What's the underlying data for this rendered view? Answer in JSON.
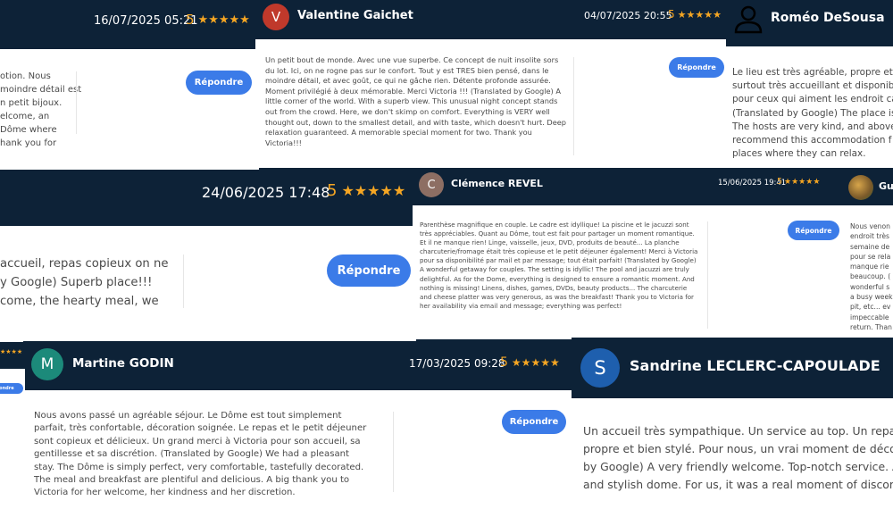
{
  "reply_label": "Répondre",
  "colors": {
    "header": "#0d2237",
    "accent_star": "#f5a623",
    "button": "#3b7be8"
  },
  "reviews": [
    {
      "author": "",
      "date": "16/07/2025 05:21",
      "rating": "5",
      "stars": "★★★★★",
      "text": "otion. Nous\nmoindre détail est\nn petit bijoux.\nelcome, an\nDôme where\nhank you for"
    },
    {
      "author": "Valentine Gaichet",
      "initial": "V",
      "date": "04/07/2025 20:55",
      "rating": "5",
      "stars": "★★★★★",
      "text": "Un petit bout de monde. Avec une vue superbe. Ce concept de nuit insolite sors du lot. Ici, on ne rogne pas sur le confort. Tout y est TRES bien pensé, dans le moindre détail, et avec goût, ce qui ne gâche rien. Détente profonde assurée. Moment privilégié à deux mémorable. Merci Victoria !!! (Translated by Google) A little corner of the world. With a superb view. This unusual night concept stands out from the crowd. Here, we don't skimp on comfort. Everything is VERY well thought out, down to the smallest detail, and with taste, which doesn't hurt. Deep relaxation guaranteed. A memorable special moment for two. Thank you Victoria!!!"
    },
    {
      "author": "Roméo DeSousa",
      "text": "Le lieu est très agréable, propre et b\nsurtout très accueillant et disponibl\npour ceux qui aiment les endroit ca\n(Translated by Google) The place is\nThe hosts are very kind, and above a\nrecommend this accommodation f\nplaces where they can relax."
    },
    {
      "date": "24/06/2025 17:48",
      "rating": "5",
      "stars": "★★★★★",
      "text": "accueil, repas copieux on ne\ny Google) Superb place!!!\ncome, the hearty meal, we"
    },
    {
      "author": "Clémence REVEL",
      "initial": "C",
      "date": "15/06/2025 19:41",
      "rating": "5",
      "stars": "★★★★★",
      "text": "Parenthèse magnifique en couple. Le cadre est idyllique! La piscine et le jacuzzi sont très appréciables. Quant au Dôme, tout est fait pour partager un moment romantique. Et il ne manque rien! Linge, vaisselle, jeux, DVD, produits de beauté... La planche charcuterie/fromage était très copieuse et le petit déjeuner également! Merci à Victoria pour sa disponibilité par mail et par message; tout était parfait! (Translated by Google) A wonderful getaway for couples. The setting is idyllic! The pool and jacuzzi are truly delightful. As for the Dome, everything is designed to ensure a romantic moment. And nothing is missing! Linens, dishes, games, DVDs, beauty products... The charcuterie and cheese platter was very generous, as was the breakfast! Thank you to Victoria for her availability via email and message; everything was perfect!"
    },
    {
      "author": "Gu",
      "text": "Nous venon\nendroit très\nsemaine de\npour se rela\nmanque rie\nbeaucoup. (\nwonderful s\na busy week\npit, etc... ev\nimpeccable\nreturn. Than"
    },
    {
      "author": "Martine GODIN",
      "initial": "M",
      "date": "17/03/2025 09:28",
      "rating": "5",
      "stars": "★★★★★",
      "text": "Nous avons passé un agréable séjour. Le Dôme est tout simplement parfait, très confortable, décoration soignée. Le repas et le petit déjeuner sont copieux et délicieux. Un grand merci à Victoria pour son accueil, sa gentillesse et sa discrétion. (Translated by Google) We had a pleasant stay. The Dôme is simply perfect, very comfortable, tastefully decorated. The meal and breakfast are plentiful and delicious. A big thank you to Victoria for her welcome, her kindness and her discretion."
    },
    {
      "author": "Sandrine LECLERC-CAPOULADE",
      "initial": "S",
      "text": "Un accueil très sympathique. Un service au top. Un repas\npropre et bien stylé. Pour nous, un vrai moment de déco\nby Google) A very friendly welcome. Top-notch service. A\nand stylish dome. For us, it was a real moment of disconn"
    },
    {
      "stars": "★★★★"
    }
  ]
}
